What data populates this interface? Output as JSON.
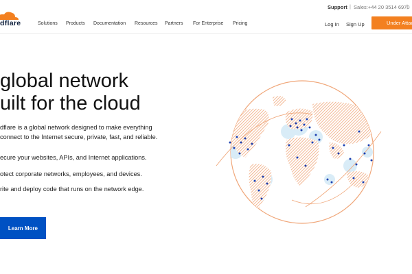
{
  "topbar": {
    "support": "Support",
    "separator": "|",
    "sales": "Sales:+44 20 3514 6970"
  },
  "brand": {
    "logo_text": "dflare",
    "icon": "cloud-logo-icon",
    "accent": "#f38020"
  },
  "nav": {
    "items": [
      {
        "label": "Solutions"
      },
      {
        "label": "Products"
      },
      {
        "label": "Documentation"
      },
      {
        "label": "Resources"
      },
      {
        "label": "Partners"
      },
      {
        "label": "For Enterprise"
      },
      {
        "label": "Pricing"
      }
    ],
    "login": "Log In",
    "signup": "Sign Up",
    "cta": "Under Attac"
  },
  "hero": {
    "headline_line1": "global network",
    "headline_line2": "uilt for the cloud",
    "lead_line1": "dflare is a global network designed to make everything",
    "lead_line2": "connect to the Internet secure, private, fast, and reliable.",
    "bullets": [
      "ecure your websites, APIs, and Internet applications.",
      "otect corporate networks, employees, and devices.",
      "rite and deploy code that runs on the network edge."
    ],
    "button": "Learn More",
    "button_color": "#0051c3"
  },
  "globe": {
    "icon": "world-network-globe-icon",
    "land_color": "#f0a77a",
    "node_color": "#1a3fb0",
    "ocean_tint": "#d9ecf7"
  }
}
